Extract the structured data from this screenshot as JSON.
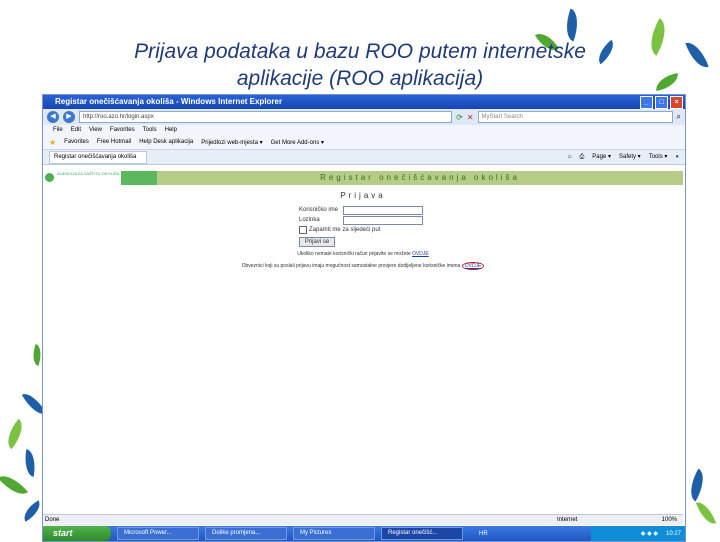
{
  "slide": {
    "title_line1": "Prijava podataka u bazu ROO putem internetske",
    "title_line2": "aplikacije (ROO aplikacija)"
  },
  "window": {
    "title": "Registar onečišćavanja okoliša - Windows Internet Explorer",
    "minimize": "_",
    "maximize": "□",
    "close": "×"
  },
  "address": {
    "url": "http://roo.azo.hr/login.aspx",
    "search_placeholder": "MyStart Search"
  },
  "menu": [
    "File",
    "Edit",
    "View",
    "Favorites",
    "Tools",
    "Help"
  ],
  "favorites": {
    "label": "Favorites",
    "items": [
      "Free Hotmail",
      "Help Desk aplikacija",
      "Prijedlozi web-mjesta ▾",
      "Get More Add-ons ▾"
    ]
  },
  "tab": {
    "label": "Registar onečišćavanja okoliša",
    "tools": [
      "Page ▾",
      "Safety ▾",
      "Tools ▾"
    ]
  },
  "page": {
    "logo_text": "AGENCIJA ZA ZAŠTITU OKOLIŠA",
    "banner": "Registar onečišćavanja okoliša",
    "heading": "Prijava",
    "username_label": "Korisničko ime",
    "password_label": "Lozinka",
    "remember_label": "Zapamti me za sljedeći put",
    "login_button": "Prijavi se",
    "msg1_text": "Ukoliko nemate korisnički račun prijavite se možete",
    "msg1_link": "OVDJE",
    "msg2_text": "Obveznici koji su poslali prijavu imaju mogućnost samostalne provjere dodijeljene korisničke imena",
    "msg2_link": "OVDJE"
  },
  "status": {
    "left": "Done",
    "zone": "Internet",
    "zoom": "100%"
  },
  "taskbar": {
    "start": "start",
    "tasks": [
      "Microsoft Power...",
      "Dolike promjena...",
      "My Pictures",
      "Registar onečišć..."
    ],
    "lang": "HR",
    "time": "10:27"
  },
  "colors": {
    "title_text": "#1f3a7a",
    "banner_green": "#b5cd85",
    "taskbar_blue": "#1f55c2"
  }
}
